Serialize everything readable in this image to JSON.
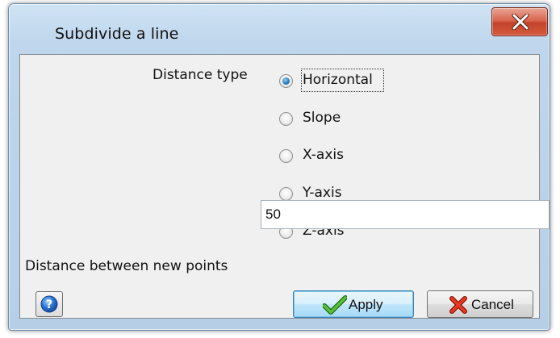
{
  "window": {
    "title": "Subdivide a line"
  },
  "form": {
    "distance_type_label": "Distance type",
    "options": [
      {
        "label": "Horizontal",
        "checked": true
      },
      {
        "label": "Slope",
        "checked": false
      },
      {
        "label": "X-axis",
        "checked": false
      },
      {
        "label": "Y-axis",
        "checked": false
      },
      {
        "label": "Z-axis",
        "checked": false
      }
    ],
    "distance_label": "Distance between new points",
    "distance_value": "50"
  },
  "buttons": {
    "apply": "Apply",
    "cancel": "Cancel"
  },
  "icons": {
    "close": "close-icon",
    "help": "help-icon",
    "apply": "checkmark-icon",
    "cancel": "cancel-x-icon"
  }
}
